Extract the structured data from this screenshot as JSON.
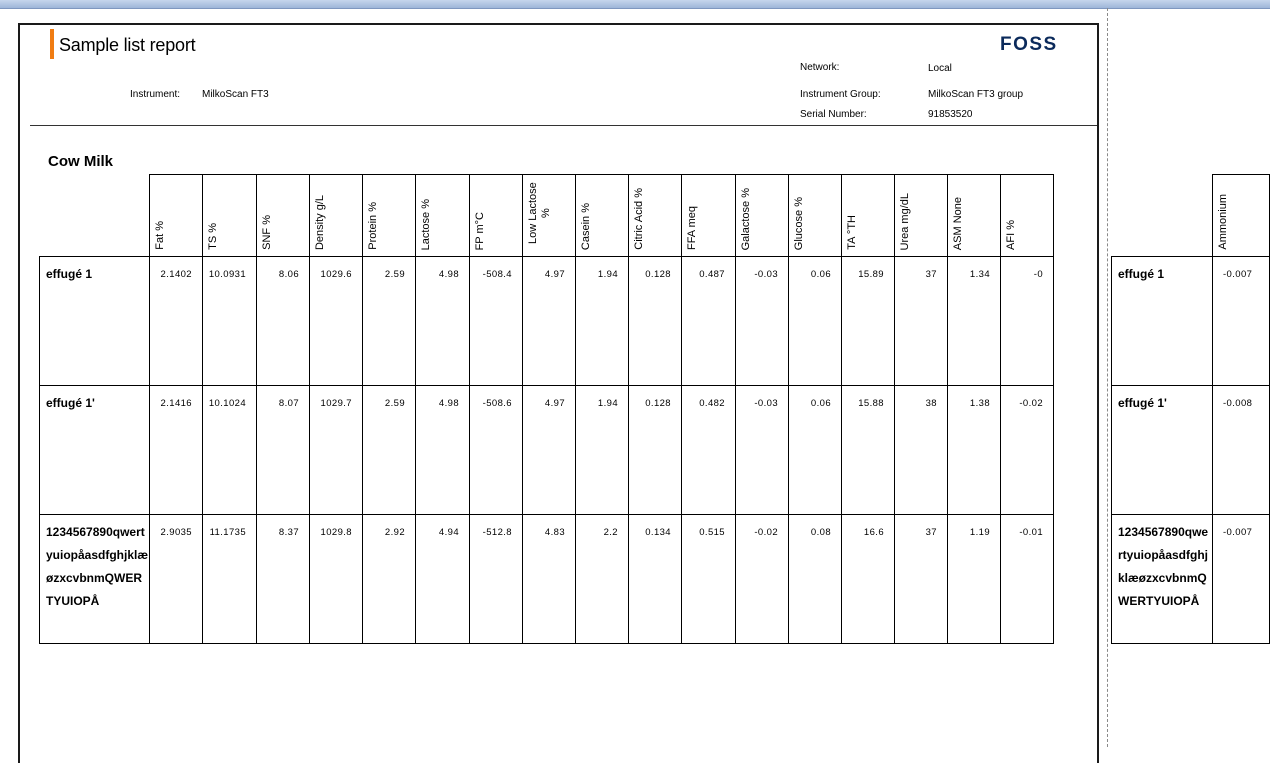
{
  "report": {
    "title": "Sample list report",
    "logo": "FOSS",
    "instrument_label": "Instrument:",
    "instrument_value": "MilkoScan FT3",
    "network_label": "Network:",
    "network_value": "Local",
    "instrument_group_label": "Instrument Group:",
    "instrument_group_value": "MilkoScan FT3 group",
    "serial_label": "Serial Number:",
    "serial_value": "91853520",
    "group_name": "Cow Milk"
  },
  "columns": [
    "Fat %",
    "TS %",
    "SNF %",
    "Density g/L",
    "Protein %",
    "Lactose %",
    "FP m°C",
    "Low Lactose %",
    "Casein %",
    "Citric Acid %",
    "FFA meq",
    "Galactose %",
    "Glucose %",
    "TA °TH",
    "Urea mg/dL",
    "ASM None",
    "AFI %"
  ],
  "rows": [
    {
      "name": "effugé 1",
      "values": [
        "2.1402",
        "10.0931",
        "8.06",
        "1029.6",
        "2.59",
        "4.98",
        "-508.4",
        "4.97",
        "1.94",
        "0.128",
        "0.487",
        "-0.03",
        "0.06",
        "15.89",
        "37",
        "1.34",
        "-0"
      ]
    },
    {
      "name": "effugé 1'",
      "values": [
        "2.1416",
        "10.1024",
        "8.07",
        "1029.7",
        "2.59",
        "4.98",
        "-508.6",
        "4.97",
        "1.94",
        "0.128",
        "0.482",
        "-0.03",
        "0.06",
        "15.88",
        "38",
        "1.38",
        "-0.02"
      ]
    },
    {
      "name": "1234567890qwertyuiopåasdfghjklæøzxcvbnmQWERTYUIOPÅ",
      "values": [
        "2.9035",
        "11.1735",
        "8.37",
        "1029.8",
        "2.92",
        "4.94",
        "-512.8",
        "4.83",
        "2.2",
        "0.134",
        "0.515",
        "-0.02",
        "0.08",
        "16.6",
        "37",
        "1.19",
        "-0.01"
      ]
    }
  ],
  "right_page": {
    "column": "Ammonium",
    "rows": [
      {
        "name": "effugé 1",
        "value": "-0.007"
      },
      {
        "name": "effugé 1'",
        "value": "-0.008"
      },
      {
        "name": "1234567890qwertyuiopåasdfghjklæøzxcvbnmQWERTYUIOPÅ",
        "value": "-0.007"
      }
    ]
  }
}
